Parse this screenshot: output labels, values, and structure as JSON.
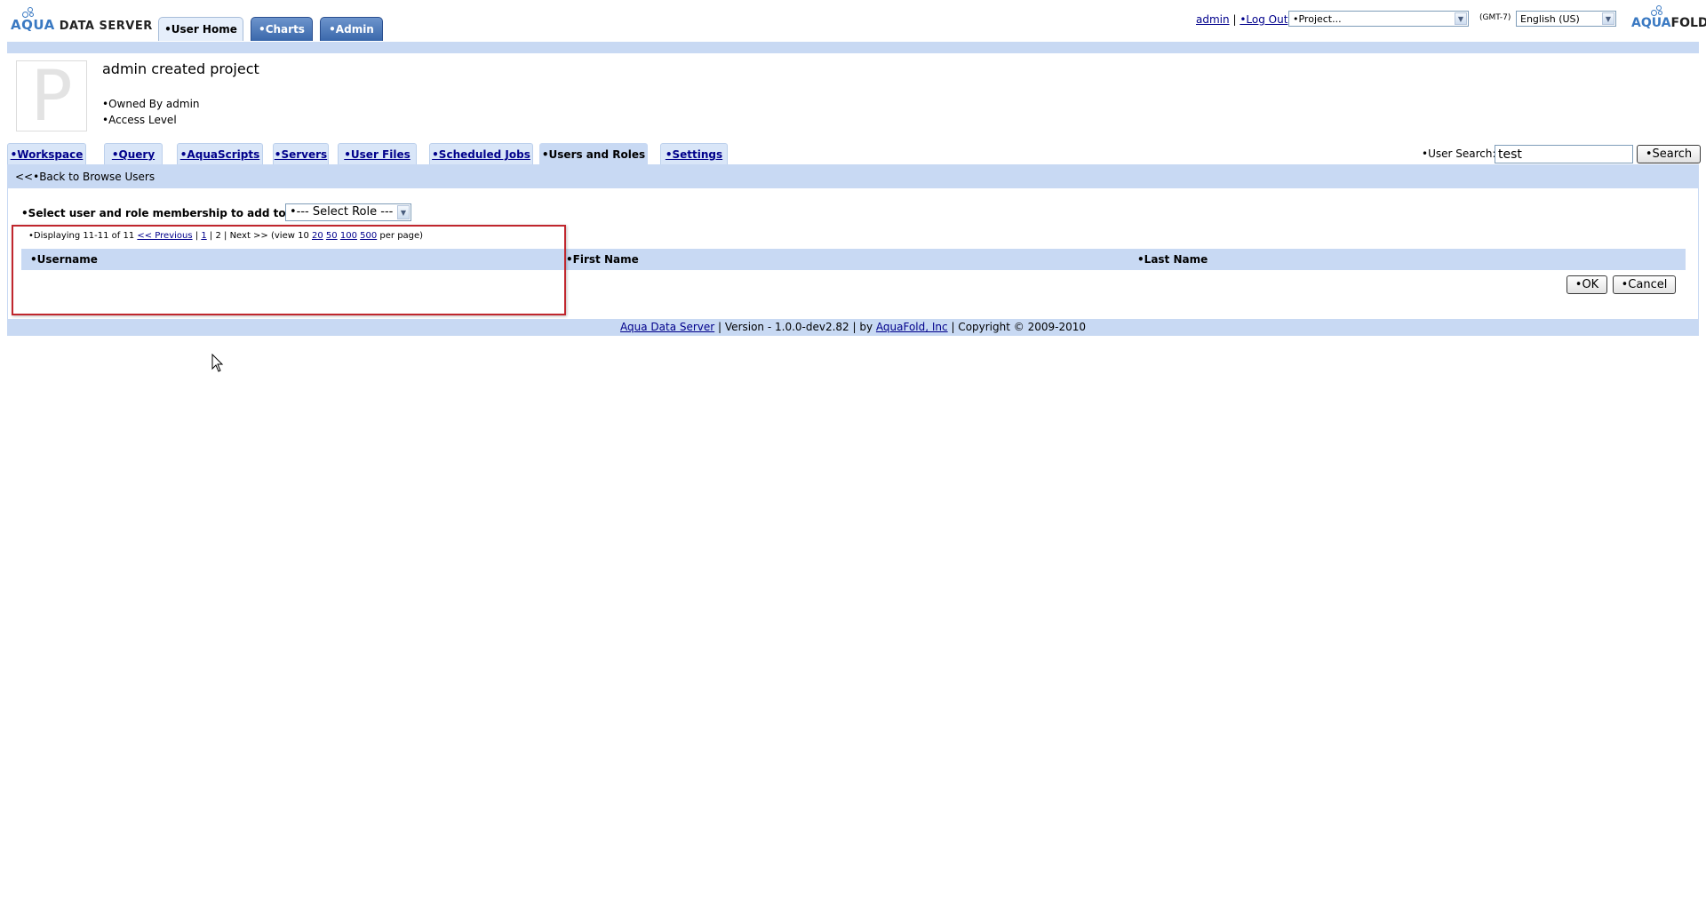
{
  "header": {
    "logo_left": {
      "part1": "AQUA",
      "part2": " DATA SERVER"
    },
    "logo_right": {
      "part1": "AQUA",
      "part2": "FOLD"
    },
    "nav_tabs": [
      {
        "label": "•User Home",
        "active": true
      },
      {
        "label": "•Charts",
        "active": false
      },
      {
        "label": "•Admin",
        "active": false
      }
    ],
    "user_link": "admin",
    "separator": "|",
    "logout_link": "•Log Out",
    "project_select": "•Project...",
    "timezone": "(GMT-7)",
    "language_select": "English (US)"
  },
  "project": {
    "icon_letter": "P",
    "title": "admin created project",
    "owned_by": "•Owned By admin",
    "access_level": "•Access Level"
  },
  "subtabs": [
    {
      "label": "•Workspace",
      "active": false
    },
    {
      "label": "•Query",
      "active": false
    },
    {
      "label": "•AquaScripts",
      "active": false
    },
    {
      "label": "•Servers",
      "active": false
    },
    {
      "label": "•User Files",
      "active": false
    },
    {
      "label": "•Scheduled Jobs",
      "active": false
    },
    {
      "label": "•Users and Roles",
      "active": true
    },
    {
      "label": "•Settings",
      "active": false
    }
  ],
  "user_search": {
    "label": "•User Search:",
    "value": "test",
    "button": "•Search"
  },
  "content": {
    "back_link": "<<•Back to Browse Users",
    "select_label": "•Select user and role membership to add to project",
    "role_select": "•--- Select Role ---",
    "pager": {
      "displaying": "•Displaying 11-11 of 11",
      "previous": "<< Previous",
      "page1": "1",
      "sep": "|",
      "page2": "2",
      "next": "| Next >> (view 10",
      "opt20": "20",
      "opt50": "50",
      "opt100": "100",
      "opt500": "500",
      "per_page": "per page)"
    },
    "table_headers": [
      "•Username",
      "•First Name",
      "•Last Name"
    ],
    "ok_button": "•OK",
    "cancel_button": "•Cancel"
  },
  "footer": {
    "product_link": "Aqua Data Server",
    "version": "| Version - 1.0.0-dev2.82 | by",
    "company_link": "AquaFold, Inc",
    "copyright": "| Copyright © 2009-2010"
  },
  "colors": {
    "accent_strip": "#c8d9f3",
    "nav_tab": "#3e6fb2",
    "highlight_box": "#c0262d",
    "link": "#00008b"
  }
}
